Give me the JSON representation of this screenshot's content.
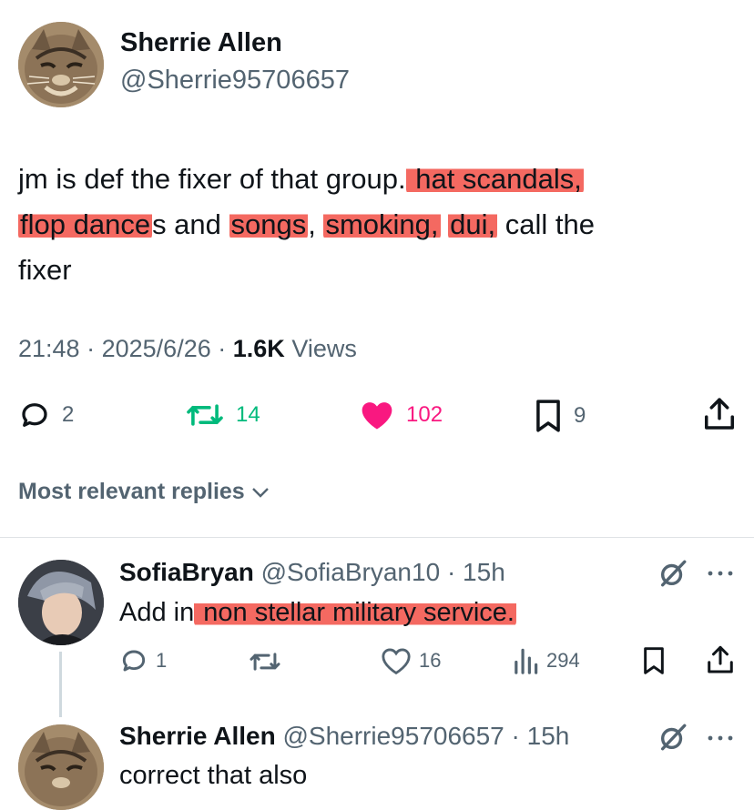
{
  "main_post": {
    "display_name": "Sherrie Allen",
    "handle": "@Sherrie95706657",
    "text_parts": {
      "p1": "jm is def the fixer of that group.",
      "hl1": " hat scandals,",
      "hl2": "flop dance",
      "p2": "s and ",
      "hl3": "songs",
      "p3": ", ",
      "hl4": "smoking,",
      "p4": " ",
      "hl5": "dui,",
      "p5": " call the",
      "p6": "fixer"
    },
    "time": "21:48",
    "date": "2025/6/26",
    "views_count": "1.6K",
    "views_label": "Views",
    "stats": {
      "replies": "2",
      "reposts": "14",
      "likes": "102",
      "bookmarks": "9"
    }
  },
  "replies_filter": {
    "label": "Most relevant replies"
  },
  "replies": [
    {
      "display_name": "SofiaBryan",
      "handle": "@SofiaBryan10",
      "time": "15h",
      "text_plain": "Add in",
      "text_highlight": " non stellar military service.",
      "stats": {
        "replies": "1",
        "likes": "16",
        "views": "294"
      }
    },
    {
      "display_name": "Sherrie Allen",
      "handle": "@Sherrie95706657",
      "time": "15h",
      "text": "correct that also"
    }
  ],
  "colors": {
    "accent_green": "#00ba7c",
    "like_pink": "#f91880",
    "highlight_red": "#f1483e",
    "muted": "#536471"
  },
  "icons": [
    "reply-icon",
    "repost-icon",
    "heart-icon",
    "bookmark-icon",
    "share-icon",
    "grok-icon",
    "more-icon",
    "views-icon",
    "chevron-down-icon"
  ]
}
